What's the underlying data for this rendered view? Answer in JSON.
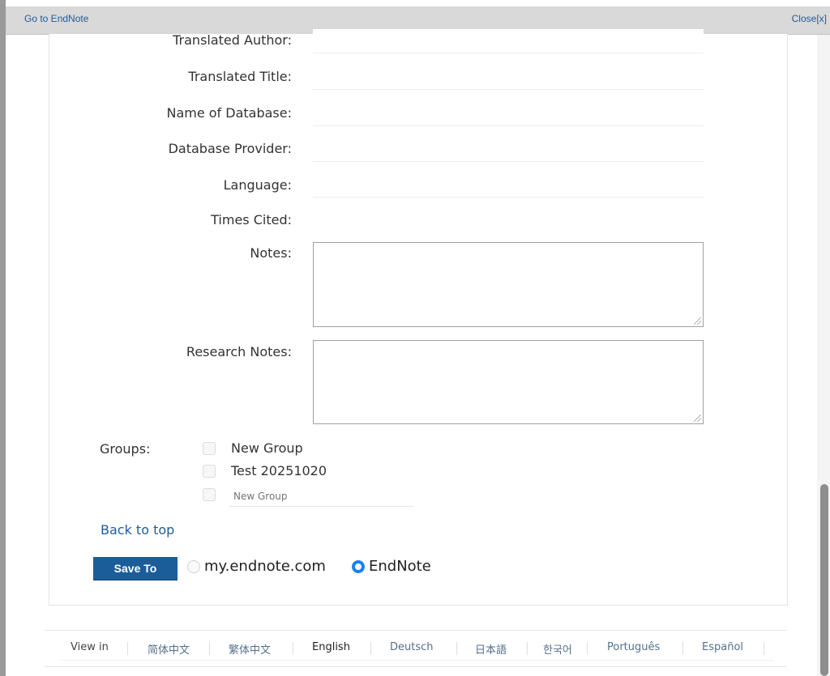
{
  "topbar": {
    "go_label": "Go to EndNote",
    "close_label": "Close[x]"
  },
  "fields": [
    {
      "label": "Translated Author:",
      "value": ""
    },
    {
      "label": "Translated Title:",
      "value": ""
    },
    {
      "label": "Name of Database:",
      "value": ""
    },
    {
      "label": "Database Provider:",
      "value": ""
    },
    {
      "label": "Language:",
      "value": ""
    },
    {
      "label": "Times Cited:",
      "value": ""
    }
  ],
  "notes": {
    "label": "Notes:",
    "value": ""
  },
  "research_notes": {
    "label": "Research Notes:",
    "value": ""
  },
  "groups": {
    "label": "Groups:",
    "items": [
      {
        "label": "New Group",
        "checked": false
      },
      {
        "label": "Test 20251020",
        "checked": false
      }
    ],
    "new_group_placeholder": "New Group"
  },
  "back_to_top": "Back to top",
  "save": {
    "button_label": "Save To",
    "options": [
      {
        "label": "my.endnote.com",
        "selected": false
      },
      {
        "label": "EndNote",
        "selected": true
      }
    ]
  },
  "footer": {
    "view_in": "View in",
    "languages": [
      "简体中文",
      "繁体中文",
      "English",
      "Deutsch",
      "日本語",
      "한국어",
      "Português",
      "Español"
    ],
    "current": "English"
  },
  "colors": {
    "accent": "#1b5d99",
    "radio_selected": "#1a82f0",
    "link": "#1f5c99"
  }
}
